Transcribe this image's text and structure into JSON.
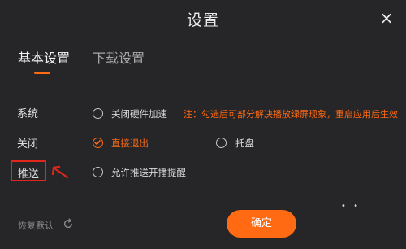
{
  "dialog": {
    "title": "设置",
    "close_glyph": "×"
  },
  "tabs": [
    {
      "label": "基本设置",
      "active": true
    },
    {
      "label": "下载设置",
      "active": false
    }
  ],
  "rows": {
    "system": {
      "label": "系统",
      "option": {
        "label": "关闭硬件加速",
        "checked": false
      },
      "note": "注：勾选后可部分解决播放绿屏现象，重启应用后生效"
    },
    "close": {
      "label": "关闭",
      "options": [
        {
          "label": "直接退出",
          "checked": true
        },
        {
          "label": "托盘",
          "checked": false
        }
      ]
    },
    "push": {
      "label": "推送",
      "option": {
        "label": "允许推送开播提醒",
        "checked": false
      }
    }
  },
  "footer": {
    "restore_label": "恢复默认",
    "restore_icon": "refresh-icon",
    "confirm_label": "确定"
  },
  "colors": {
    "accent": "#ff6a13",
    "background": "#262628",
    "highlight_box": "#e0261a"
  }
}
